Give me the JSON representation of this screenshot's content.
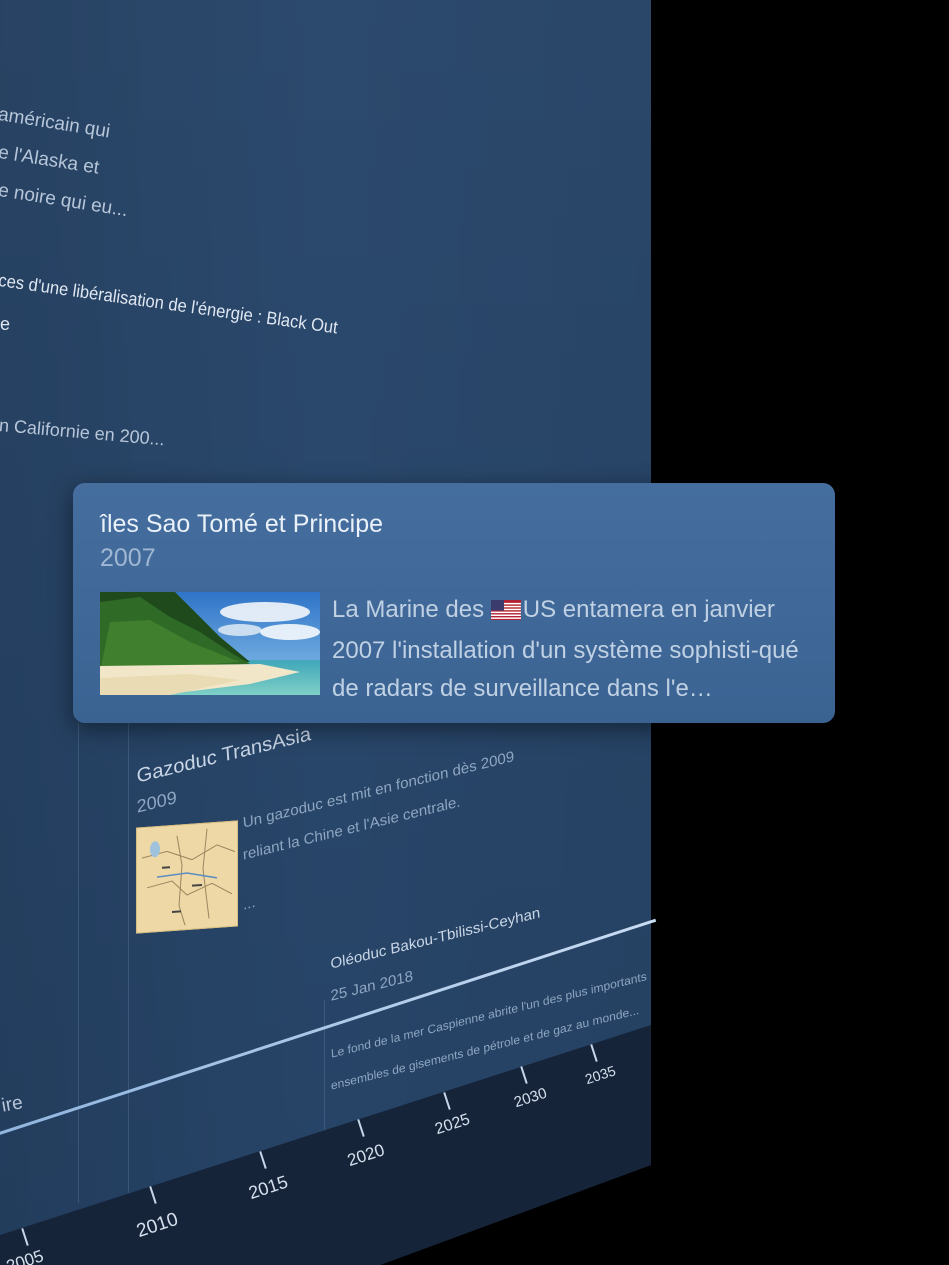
{
  "card": {
    "title": "îles Sao Tomé et Principe",
    "year": "2007",
    "text_before_flag": "La Marine des ",
    "flag_icon": "us-flag-icon",
    "text_after_flag": "US entamera en janvier 2007 l'installation d'un système sophisti-qué de radars de surveillance dans l'e…"
  },
  "background_events": {
    "fragment_1": [
      "américain qui",
      "e l'Alaska et",
      "e noire qui eu..."
    ],
    "fragment_2": [
      "ces d'une libéralisation de l'énergie : Black Out",
      "e"
    ],
    "fragment_3": "n Californie en 200...",
    "fragment_4": "ire",
    "gazoduc": {
      "title": "Gazoduc TransAsia",
      "year": "2009",
      "text": [
        "Un gazoduc est mit en fonction dès 2009",
        "reliant la Chine et l'Asie centrale.",
        "..."
      ]
    },
    "oleoduc": {
      "title": "Oléoduc Bakou-Tbilissi-Ceyhan",
      "date": "25 Jan 2018",
      "text": [
        "Le fond de la mer Caspienne abrite l'un des plus importants",
        "ensembles de gisements de pétrole et de gaz au monde..."
      ]
    }
  },
  "timeline": {
    "labels": [
      "2005",
      "2010",
      "2015",
      "2020",
      "2025",
      "2030",
      "2035"
    ]
  },
  "colors": {
    "background": "#000000",
    "panel": "#2a486c",
    "card": "#416a9a",
    "axis": "#16243a"
  }
}
